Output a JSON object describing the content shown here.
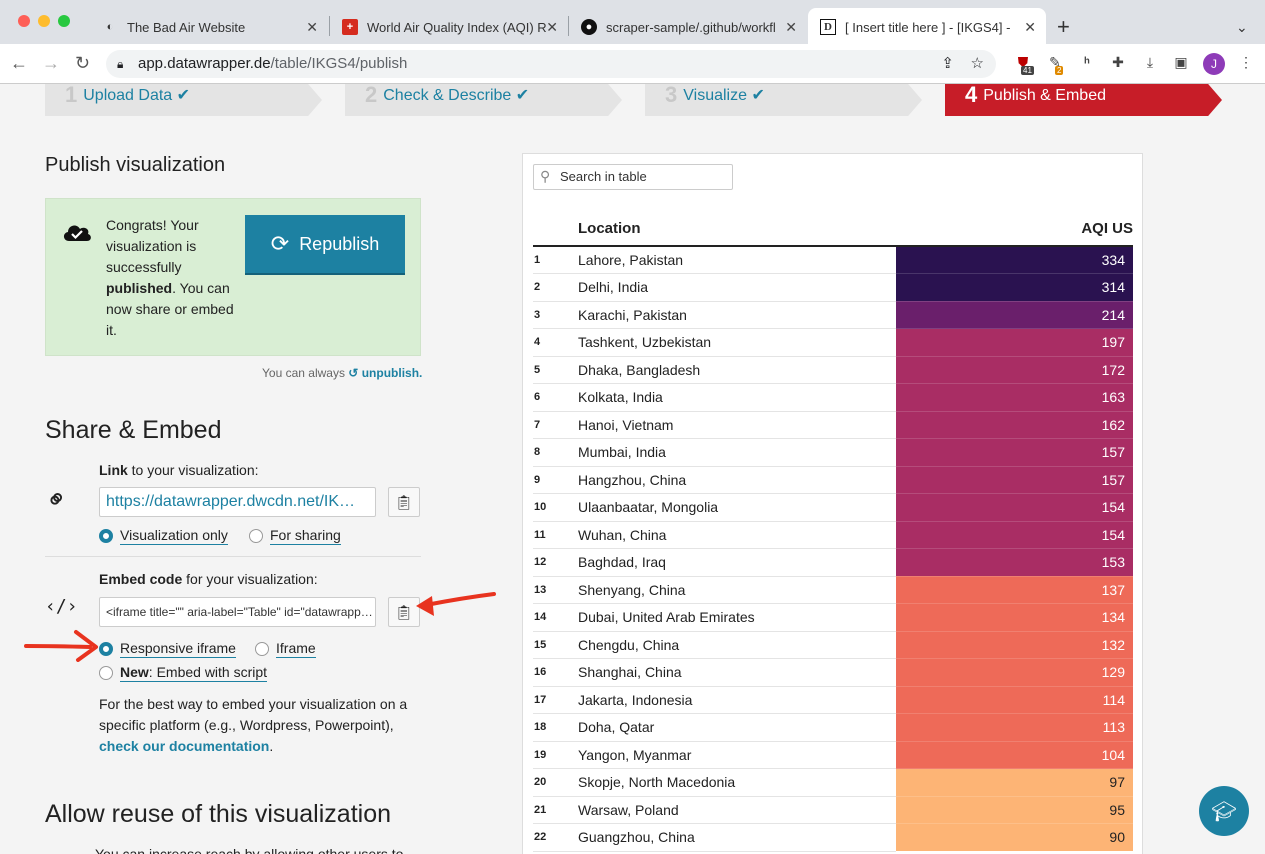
{
  "browser": {
    "tabs": [
      {
        "title": "The Bad Air Website"
      },
      {
        "title": "World Air Quality Index (AQI) R"
      },
      {
        "title": "scraper-sample/.github/workfl"
      },
      {
        "title": "[ Insert title here ] - [IKGS4] -"
      }
    ],
    "new_tab": "+",
    "url_host": "app.datawrapper.de",
    "url_path": "/table/IKGS4/publish",
    "ext_badge_1": "41",
    "ext_badge_2": "2",
    "profile_initial": "J"
  },
  "steps": [
    {
      "num": "1",
      "label": "Upload Data ✔"
    },
    {
      "num": "2",
      "label": "Check & Describe ✔"
    },
    {
      "num": "3",
      "label": "Visualize ✔"
    },
    {
      "num": "4",
      "label": "Publish & Embed"
    }
  ],
  "publish": {
    "heading": "Publish visualization",
    "msg_a": "Congrats! Your visualization is successfully ",
    "msg_b": "published",
    "msg_c": ". You can now share or embed it.",
    "republish": "Republish",
    "unpublish_pre": "You can always",
    "unpublish_link": "unpublish."
  },
  "share": {
    "heading": "Share & Embed",
    "link_bold": "Link",
    "link_rest": " to your visualization:",
    "link_value": "https://datawrapper.dwcdn.net/IK…",
    "opt_viz_only": "Visualization only",
    "opt_for_sharing": "For sharing",
    "embed_bold": "Embed code",
    "embed_rest": " for your visualization:",
    "embed_value": "<iframe title=\"\" aria-label=\"Table\" id=\"datawrapp…",
    "opt_responsive": "Responsive iframe",
    "opt_iframe": "Iframe",
    "opt_new_bold": "New",
    "opt_new_rest": ": Embed with script",
    "help_text": "For the best way to embed your visualization on a specific platform (e.g., Wordpress, Powerpoint),",
    "help_link": "check our documentation",
    "help_end": "."
  },
  "reuse": {
    "heading": "Allow reuse of this visualization",
    "cut_text": "You can increase reach by allowing other users to"
  },
  "table": {
    "search_placeholder": "Search in table",
    "col_location": "Location",
    "col_aqi": "AQI US",
    "rows": [
      {
        "rank": "1",
        "location": "Lahore, Pakistan",
        "aqi": "334",
        "color": "#2a1250"
      },
      {
        "rank": "2",
        "location": "Delhi, India",
        "aqi": "314",
        "color": "#2a1250"
      },
      {
        "rank": "3",
        "location": "Karachi, Pakistan",
        "aqi": "214",
        "color": "#6a1f6b"
      },
      {
        "rank": "4",
        "location": "Tashkent, Uzbekistan",
        "aqi": "197",
        "color": "#a92d64"
      },
      {
        "rank": "5",
        "location": "Dhaka, Bangladesh",
        "aqi": "172",
        "color": "#a92d64"
      },
      {
        "rank": "6",
        "location": "Kolkata, India",
        "aqi": "163",
        "color": "#a92d64"
      },
      {
        "rank": "7",
        "location": "Hanoi, Vietnam",
        "aqi": "162",
        "color": "#a92d64"
      },
      {
        "rank": "8",
        "location": "Mumbai, India",
        "aqi": "157",
        "color": "#a92d64"
      },
      {
        "rank": "9",
        "location": "Hangzhou, China",
        "aqi": "157",
        "color": "#a92d64"
      },
      {
        "rank": "10",
        "location": "Ulaanbaatar, Mongolia",
        "aqi": "154",
        "color": "#a92d64"
      },
      {
        "rank": "11",
        "location": "Wuhan, China",
        "aqi": "154",
        "color": "#a92d64"
      },
      {
        "rank": "12",
        "location": "Baghdad, Iraq",
        "aqi": "153",
        "color": "#a92d64"
      },
      {
        "rank": "13",
        "location": "Shenyang, China",
        "aqi": "137",
        "color": "#ee6a58"
      },
      {
        "rank": "14",
        "location": "Dubai, United Arab Emirates",
        "aqi": "134",
        "color": "#ee6a58"
      },
      {
        "rank": "15",
        "location": "Chengdu, China",
        "aqi": "132",
        "color": "#ee6a58"
      },
      {
        "rank": "16",
        "location": "Shanghai, China",
        "aqi": "129",
        "color": "#ee6a58"
      },
      {
        "rank": "17",
        "location": "Jakarta, Indonesia",
        "aqi": "114",
        "color": "#ee6a58"
      },
      {
        "rank": "18",
        "location": "Doha, Qatar",
        "aqi": "113",
        "color": "#ee6a58"
      },
      {
        "rank": "19",
        "location": "Yangon, Myanmar",
        "aqi": "104",
        "color": "#ee6a58"
      },
      {
        "rank": "20",
        "location": "Skopje, North Macedonia",
        "aqi": "97",
        "color": "#fdb475"
      },
      {
        "rank": "21",
        "location": "Warsaw, Poland",
        "aqi": "95",
        "color": "#fdb475"
      },
      {
        "rank": "22",
        "location": "Guangzhou, China",
        "aqi": "90",
        "color": "#fdb475"
      }
    ]
  },
  "colors": {
    "accent": "#1d81a2",
    "active_step": "#c71d28",
    "success_bg": "#d9eed4",
    "arrow": "#e8331f"
  }
}
